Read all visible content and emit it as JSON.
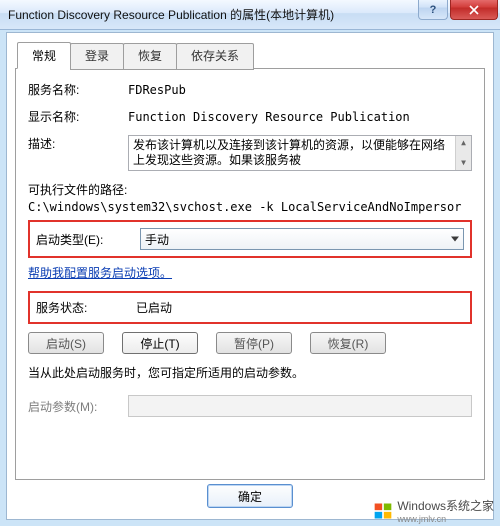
{
  "window": {
    "title": "Function Discovery Resource Publication 的属性(本地计算机)"
  },
  "tabs": {
    "general": "常规",
    "logon": "登录",
    "recovery": "恢复",
    "dependencies": "依存关系"
  },
  "labels": {
    "service_name": "服务名称:",
    "display_name": "显示名称:",
    "description": "描述:",
    "exe_path": "可执行文件的路径:",
    "startup_type": "启动类型(E):",
    "help_link": "帮助我配置服务启动选项。",
    "service_status": "服务状态:",
    "hint": "当从此处启动服务时，您可指定所适用的启动参数。",
    "start_params": "启动参数(M):"
  },
  "values": {
    "service_name": "FDResPub",
    "display_name": "Function Discovery Resource Publication",
    "description": "发布该计算机以及连接到该计算机的资源，以便能够在网络上发现这些资源。如果该服务被",
    "exe_path": "C:\\windows\\system32\\svchost.exe -k LocalServiceAndNoImpersor",
    "startup_type": "手动",
    "service_status": "已启动",
    "start_params": ""
  },
  "buttons": {
    "start": "启动(S)",
    "stop": "停止(T)",
    "pause": "暂停(P)",
    "resume": "恢复(R)",
    "ok": "确定"
  },
  "watermark": {
    "text": "Windows系统之家",
    "sub": "www.jmlv.cn"
  }
}
